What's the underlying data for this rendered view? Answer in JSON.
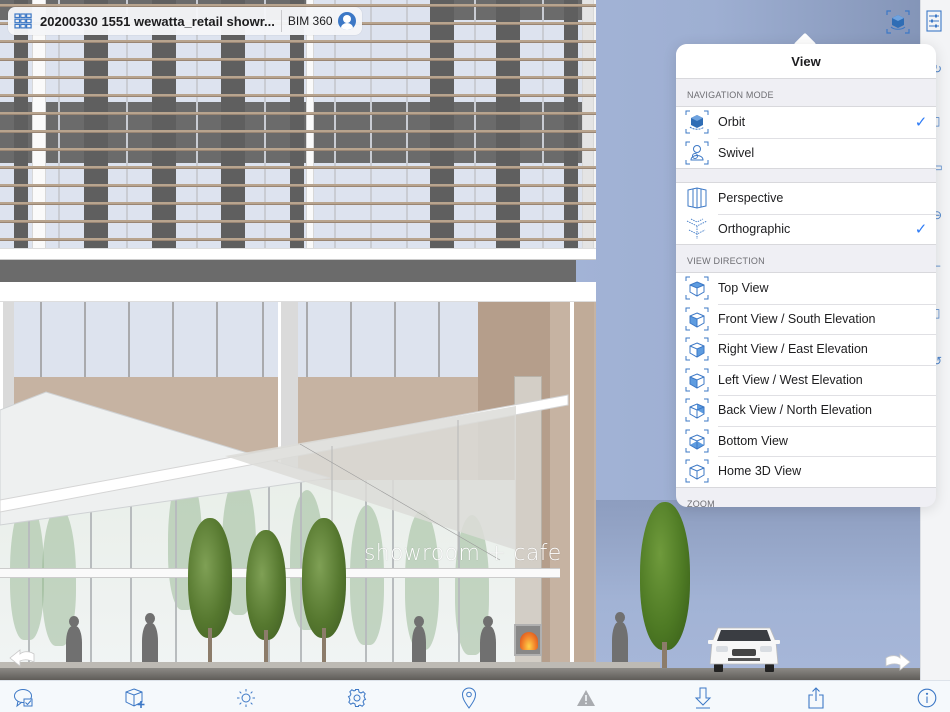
{
  "header": {
    "document_title": "20200330 1551 wewatta_retail showr...",
    "hub_label": "BIM 360",
    "grid_icon": "grid-icon",
    "avatar_icon": "user-avatar-icon"
  },
  "colors": {
    "accent": "#3c78c6",
    "checkmark": "#2f7cf6",
    "popover_bg": "#efeff4",
    "sky": "#a2b3d6"
  },
  "scene": {
    "sign_text": "showroom + cafe",
    "nav_left_icon": "arrow-back-icon",
    "nav_right_icon": "arrow-forward-icon"
  },
  "top_right_tools": [
    {
      "name": "view-cube-button",
      "icon": "orbit-cube-icon"
    },
    {
      "name": "properties-button",
      "icon": "sliders-icon"
    }
  ],
  "view_popover": {
    "title": "View",
    "sections": {
      "navigation_mode": {
        "header": "NAVIGATION MODE",
        "items": [
          {
            "label": "Orbit",
            "icon": "orbit-icon",
            "checked": true
          },
          {
            "label": "Swivel",
            "icon": "swivel-icon",
            "checked": false
          }
        ]
      },
      "projection": {
        "items": [
          {
            "label": "Perspective",
            "icon": "perspective-icon",
            "checked": false
          },
          {
            "label": "Orthographic",
            "icon": "orthographic-icon",
            "checked": true
          }
        ]
      },
      "view_direction": {
        "header": "VIEW DIRECTION",
        "items": [
          {
            "label": "Top View",
            "icon": "top-view-icon"
          },
          {
            "label": "Front View / South Elevation",
            "icon": "front-view-icon"
          },
          {
            "label": "Right View / East Elevation",
            "icon": "right-view-icon"
          },
          {
            "label": "Left View / West Elevation",
            "icon": "left-view-icon"
          },
          {
            "label": "Back View / North Elevation",
            "icon": "back-view-icon"
          },
          {
            "label": "Bottom View",
            "icon": "bottom-view-icon"
          },
          {
            "label": "Home 3D View",
            "icon": "home-3d-view-icon"
          }
        ]
      },
      "zoom": {
        "header": "ZOOM"
      }
    },
    "checkmark_glyph": "✓"
  },
  "toolbar": {
    "buttons": [
      {
        "name": "markup-button",
        "icon": "markup-bubble-icon",
        "enabled": true
      },
      {
        "name": "add-view-button",
        "icon": "cube-add-icon",
        "enabled": true
      },
      {
        "name": "lighting-button",
        "icon": "sun-icon",
        "enabled": true
      },
      {
        "name": "settings-button",
        "icon": "gear-icon",
        "enabled": true
      },
      {
        "name": "location-button",
        "icon": "map-pin-icon",
        "enabled": true
      },
      {
        "name": "issues-button",
        "icon": "warning-icon",
        "enabled": false
      },
      {
        "name": "download-button",
        "icon": "download-icon",
        "enabled": true
      },
      {
        "name": "share-button",
        "icon": "share-icon",
        "enabled": true
      },
      {
        "name": "info-button",
        "icon": "info-icon",
        "enabled": true
      }
    ]
  }
}
